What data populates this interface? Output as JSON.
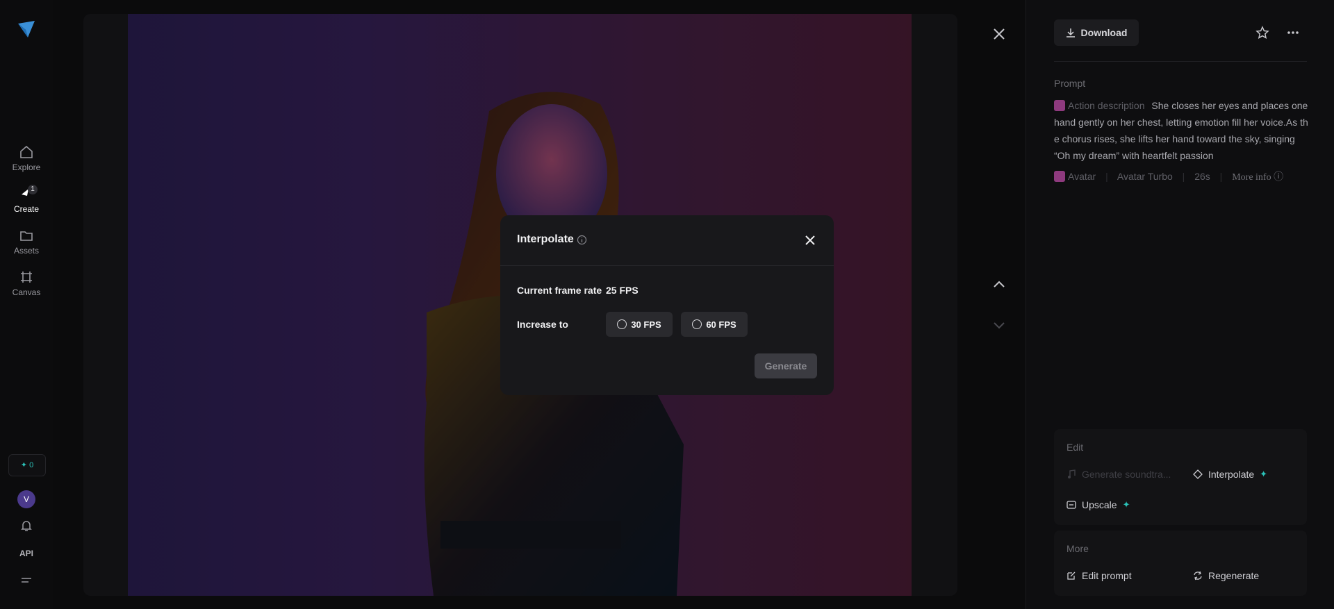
{
  "sidebar": {
    "items": [
      {
        "label": "Explore",
        "icon": "home-icon"
      },
      {
        "label": "Create",
        "icon": "create-icon",
        "badge": "1"
      },
      {
        "label": "Assets",
        "icon": "folder-icon"
      },
      {
        "label": "Canvas",
        "icon": "canvas-icon"
      }
    ],
    "credits": "✦ 0",
    "avatar_letter": "V",
    "api_label": "API"
  },
  "panel": {
    "download_label": "Download",
    "prompt_label": "Prompt",
    "action_label": "Action description",
    "prompt_text": "She closes her eyes and places one hand gently on her chest, letting emotion fill her voice.As the chorus rises, she lifts her hand toward the sky, singing “Oh my dream” with heartfelt passion",
    "meta": {
      "model": "Avatar",
      "variant": "Avatar Turbo",
      "duration": "26s",
      "more_info": "More info"
    },
    "edit": {
      "title": "Edit",
      "generate_soundtrack": "Generate soundtra...",
      "interpolate": "Interpolate",
      "upscale": "Upscale"
    },
    "more": {
      "title": "More",
      "edit_prompt": "Edit prompt",
      "regenerate": "Regenerate"
    }
  },
  "modal": {
    "title": "Interpolate",
    "current_label": "Current frame rate",
    "current_value": "25 FPS",
    "increase_label": "Increase to",
    "options": [
      "30 FPS",
      "60 FPS"
    ],
    "generate_label": "Generate"
  },
  "colors": {
    "accent": "#2bc2b8",
    "background": "#0b0b0c",
    "modal": "#18181b"
  }
}
